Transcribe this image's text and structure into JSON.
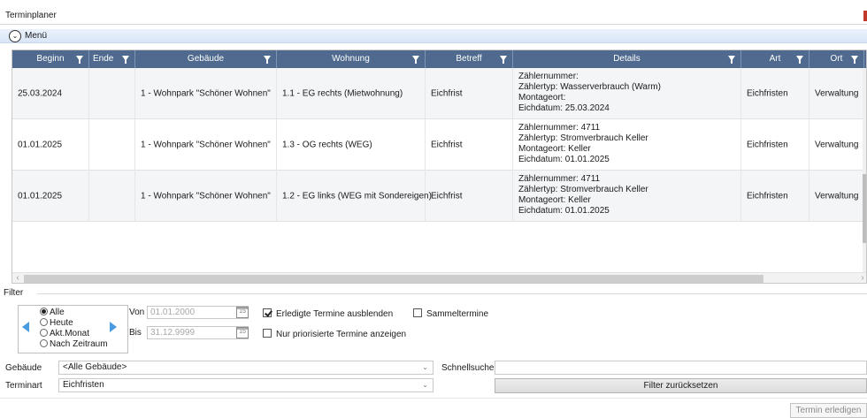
{
  "window": {
    "title": "Terminplaner"
  },
  "menu": {
    "label": "Menü"
  },
  "grid": {
    "columns": [
      "Beginn",
      "Ende",
      "Gebäude",
      "Wohnung",
      "Betreff",
      "Details",
      "Art",
      "Ort"
    ],
    "rows": [
      {
        "beginn": "25.03.2024",
        "ende": "",
        "gebaeude": "1 - Wohnpark \"Schöner Wohnen\"",
        "wohnung": "1.1 - EG rechts (Mietwohnung)",
        "betreff": "Eichfrist",
        "details": [
          "Zählernummer:",
          "Zählertyp: Wasserverbrauch (Warm)",
          "Montageort:",
          "Eichdatum: 25.03.2024"
        ],
        "art": "Eichfristen",
        "ort": "Verwaltung"
      },
      {
        "beginn": "01.01.2025",
        "ende": "",
        "gebaeude": "1 - Wohnpark \"Schöner Wohnen\"",
        "wohnung": "1.3 - OG rechts (WEG)",
        "betreff": "Eichfrist",
        "details": [
          "Zählernummer: 4711",
          "Zählertyp: Stromverbrauch Keller",
          "Montageort: Keller",
          "Eichdatum: 01.01.2025"
        ],
        "art": "Eichfristen",
        "ort": "Verwaltung"
      },
      {
        "beginn": "01.01.2025",
        "ende": "",
        "gebaeude": "1 - Wohnpark \"Schöner Wohnen\"",
        "wohnung": "1.2 - EG links (WEG mit Sondereigen)",
        "betreff": "Eichfrist",
        "details": [
          "Zählernummer: 4711",
          "Zählertyp: Stromverbrauch Keller",
          "Montageort: Keller",
          "Eichdatum: 01.01.2025"
        ],
        "art": "Eichfristen",
        "ort": "Verwaltung"
      }
    ]
  },
  "filter": {
    "legend": "Filter",
    "period_options": [
      "Alle",
      "Heute",
      "Akt.Monat",
      "Nach Zeitraum"
    ],
    "period_selected": "Alle",
    "von_label": "Von",
    "von_value": "01.01.2000",
    "bis_label": "Bis",
    "bis_value": "31.12.9999",
    "calendar_day": "15",
    "erledigte_label": "Erledigte Termine ausblenden",
    "erledigte_checked": true,
    "sammel_label": "Sammeltermine",
    "sammel_checked": false,
    "priorisiert_label": "Nur priorisierte Termine anzeigen",
    "priorisiert_checked": false,
    "gebaeude_label": "Gebäude",
    "gebaeude_value": "<Alle Gebäude>",
    "terminart_label": "Terminart",
    "terminart_value": "Eichfristen",
    "schnellsuche_label": "Schnellsuche",
    "schnellsuche_value": "",
    "reset_label": "Filter zurücksetzen"
  },
  "actions": {
    "done_label": "Termin erledigen"
  },
  "colors": {
    "header_bg": "#4f6a8e",
    "menubar_bg": "#d9e6f7",
    "nav_arrow": "#4a9be0"
  }
}
